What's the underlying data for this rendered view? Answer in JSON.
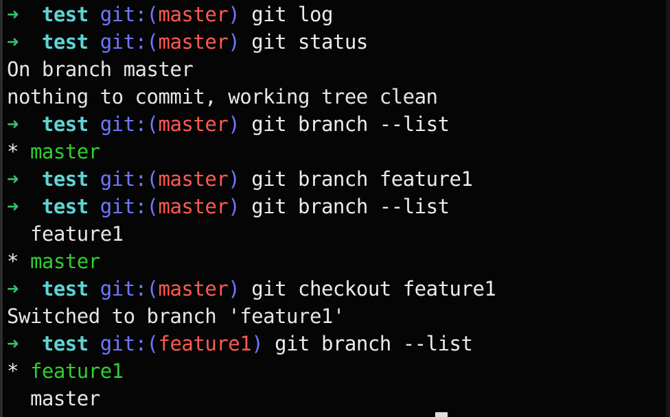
{
  "terminal": {
    "lines": [
      {
        "type": "prompt",
        "arrow": "➜",
        "dir": "test",
        "git_prefix": "git:(",
        "branch": "master",
        "git_suffix": ")",
        "command": "git log"
      },
      {
        "type": "prompt",
        "arrow": "➜",
        "dir": "test",
        "git_prefix": "git:(",
        "branch": "master",
        "git_suffix": ")",
        "command": "git status"
      },
      {
        "type": "output",
        "text": "On branch master"
      },
      {
        "type": "output",
        "text": "nothing to commit, working tree clean"
      },
      {
        "type": "prompt",
        "arrow": "➜",
        "dir": "test",
        "git_prefix": "git:(",
        "branch": "master",
        "git_suffix": ")",
        "command": "git branch --list"
      },
      {
        "type": "branch",
        "marker": "*",
        "name": "master",
        "current": true
      },
      {
        "type": "prompt",
        "arrow": "➜",
        "dir": "test",
        "git_prefix": "git:(",
        "branch": "master",
        "git_suffix": ")",
        "command": "git branch feature1"
      },
      {
        "type": "prompt",
        "arrow": "➜",
        "dir": "test",
        "git_prefix": "git:(",
        "branch": "master",
        "git_suffix": ")",
        "command": "git branch --list"
      },
      {
        "type": "branch",
        "marker": " ",
        "name": "feature1",
        "current": false
      },
      {
        "type": "branch",
        "marker": "*",
        "name": "master",
        "current": true
      },
      {
        "type": "prompt",
        "arrow": "➜",
        "dir": "test",
        "git_prefix": "git:(",
        "branch": "master",
        "git_suffix": ")",
        "command": "git checkout feature1"
      },
      {
        "type": "output",
        "text": "Switched to branch 'feature1'"
      },
      {
        "type": "prompt",
        "arrow": "➜",
        "dir": "test",
        "git_prefix": "git:(",
        "branch": "feature1",
        "git_suffix": ")",
        "command": "git branch --list"
      },
      {
        "type": "branch",
        "marker": "*",
        "name": "feature1",
        "current": true
      },
      {
        "type": "branch",
        "marker": " ",
        "name": "master",
        "current": false
      }
    ]
  },
  "colors": {
    "background": "#050505",
    "arrow": "#34c26b",
    "directory": "#5fd4d4",
    "git_label": "#6f78ff",
    "branch_name": "#ff5a52",
    "current_branch": "#2fd02f",
    "text": "#e6e6e6"
  }
}
